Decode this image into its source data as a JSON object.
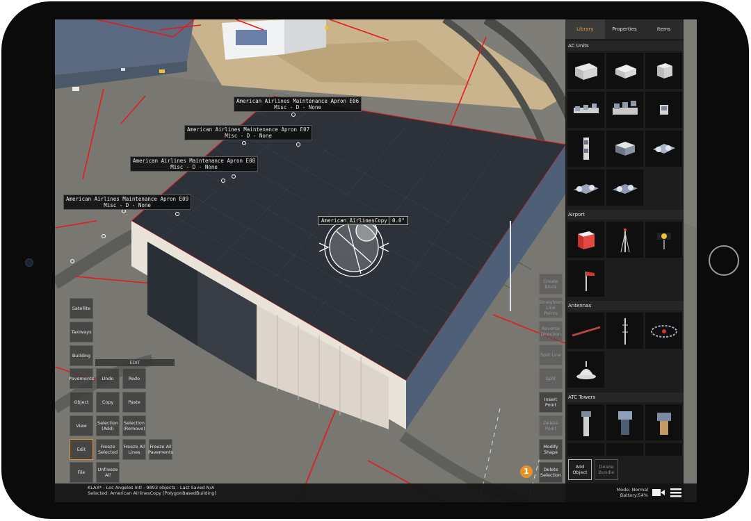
{
  "labels": {
    "e06": {
      "line1": "American Airlines Maintenance Apron E06",
      "line2": "Misc - D - None"
    },
    "e07": {
      "line1": "American Airlines Maintenance Apron E07",
      "line2": "Misc - D - None"
    },
    "e08": {
      "line1": "American Airlines Maintenance Apron E08",
      "line2": "Misc - D - None"
    },
    "e09": {
      "line1": "American Airlines Maintenance Apron E09",
      "line2": "Misc - D - None"
    }
  },
  "selected_object": {
    "name": "American AirlinesCopy",
    "rotation": "0.0°"
  },
  "left_toolbar": {
    "satellite": "Satellite",
    "taxiways": "Taxiways",
    "building": "Building",
    "pavements": "Pavements",
    "object": "Object",
    "view": "View",
    "edit": "Edit",
    "file": "File"
  },
  "edit_menu": {
    "header": "EDIT",
    "undo": "Undo",
    "redo": "Redo",
    "copy": "Copy",
    "paste": "Paste",
    "selection_add": "Selection (Add)",
    "selection_remove": "Selection (Remove)",
    "freeze_selected": "Freeze Selected",
    "freeze_all_lines": "Freeze All Lines",
    "freeze_all_pavements": "Freeze All Pavements",
    "unfreeze_all": "Unfreeze All"
  },
  "right_toolbar": {
    "create_block": "Create Block",
    "straighten": "Straighten Line Points",
    "reverse": "Reverse Direction",
    "split_line": "Split Line",
    "split": "Split",
    "insert_point": "Insert Point",
    "delete_point": "Delete Point",
    "modify_shape": "Modify Shape",
    "delete_selection": "Delete Selection"
  },
  "panel": {
    "tabs": [
      "Library",
      "Properties",
      "Items"
    ],
    "categories": {
      "ac_units": "AC Units",
      "airport": "Airport",
      "antennas": "Antennas",
      "atc_towers": "ATC Towers"
    },
    "add_object": "Add Object",
    "delete_bundle": "Delete Bundle"
  },
  "status": {
    "line1": "KLAX* - Los Angeles Intl - 9893 objects - Last Saved N/A",
    "line2": "Selected: American AirlinesCopy [PolygonBasedBuilding]"
  },
  "mode": {
    "line1": "Mode: Normal",
    "line2": "Battery:54%"
  },
  "badge": "1",
  "icons": [
    "video-camera-icon",
    "hamburger-menu-icon"
  ],
  "colors": {
    "accent": "#e9a23b",
    "guide_line": "#e31b1b"
  }
}
